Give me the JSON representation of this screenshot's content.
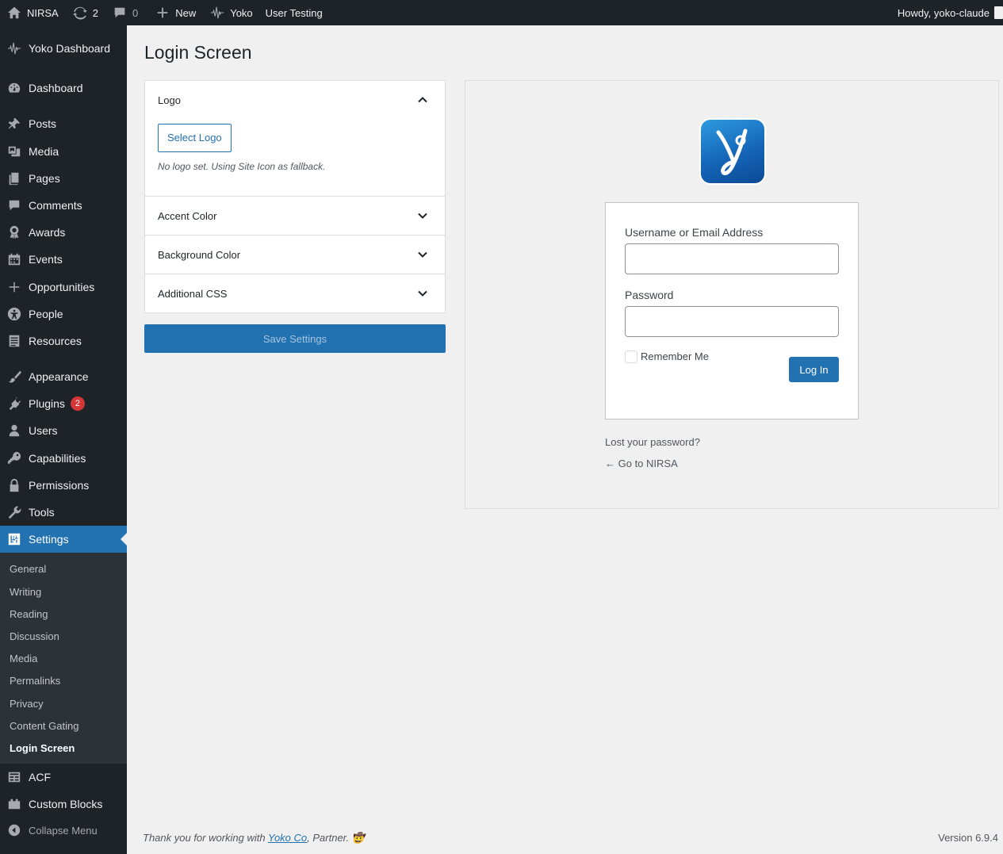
{
  "admin_bar": {
    "site_name": "NIRSA",
    "updates_count": "2",
    "comments_count": "0",
    "new_label": "New",
    "yoko_label": "Yoko",
    "user_testing_label": "User Testing",
    "howdy": "Howdy, yoko-claude"
  },
  "sidebar": {
    "brand": "Yoko Dashboard",
    "items": {
      "dashboard": "Dashboard",
      "posts": "Posts",
      "media": "Media",
      "pages": "Pages",
      "comments": "Comments",
      "awards": "Awards",
      "events": "Events",
      "opportunities": "Opportunities",
      "people": "People",
      "resources": "Resources",
      "appearance": "Appearance",
      "plugins": "Plugins",
      "plugins_badge": "2",
      "users": "Users",
      "capabilities": "Capabilities",
      "permissions": "Permissions",
      "tools": "Tools",
      "settings": "Settings",
      "acf": "ACF",
      "custom_blocks": "Custom Blocks",
      "collapse": "Collapse Menu"
    },
    "settings_submenu": {
      "general": "General",
      "writing": "Writing",
      "reading": "Reading",
      "discussion": "Discussion",
      "media": "Media",
      "permalinks": "Permalinks",
      "privacy": "Privacy",
      "content_gating": "Content Gating",
      "login_screen": "Login Screen"
    }
  },
  "main": {
    "title": "Login Screen",
    "panel": {
      "logo": {
        "title": "Logo",
        "select_button": "Select Logo",
        "help": "No logo set. Using Site Icon as fallback."
      },
      "accent_color": "Accent Color",
      "background_color": "Background Color",
      "additional_css": "Additional CSS"
    },
    "save_button": "Save Settings"
  },
  "preview": {
    "username_label": "Username or Email Address",
    "password_label": "Password",
    "remember_me": "Remember Me",
    "login_button": "Log In",
    "lost_password": "Lost your password?",
    "go_to_site": "← Go to NIRSA"
  },
  "footer": {
    "thanks_prefix": "Thank you for working with ",
    "thanks_link": "Yoko Co",
    "thanks_suffix": ", Partner. 🤠",
    "version": "Version 6.9.4"
  }
}
